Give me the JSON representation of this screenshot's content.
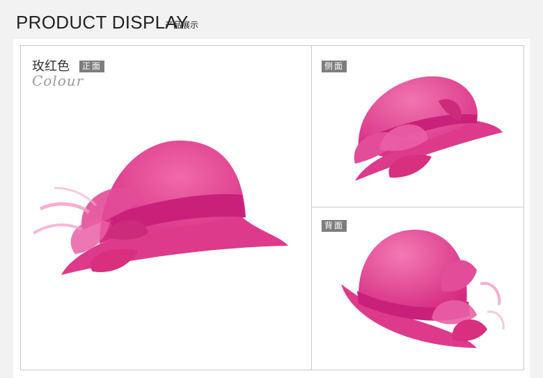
{
  "header": {
    "title": "PRODUCT DISPLAY",
    "subtitle": "产品展示"
  },
  "front": {
    "color_name": "玫红色",
    "view_tag": "正面",
    "colour_label": "Colour",
    "image": "hat-front-photo"
  },
  "side": {
    "view_tag": "侧面",
    "image": "hat-side-photo"
  },
  "back": {
    "view_tag": "背面",
    "image": "hat-back-photo"
  },
  "colors": {
    "hat_pink": "#e6378f",
    "tag_bg": "#7d7d7d",
    "border": "#c9c9c9",
    "page_bg": "#f2f2f2"
  }
}
